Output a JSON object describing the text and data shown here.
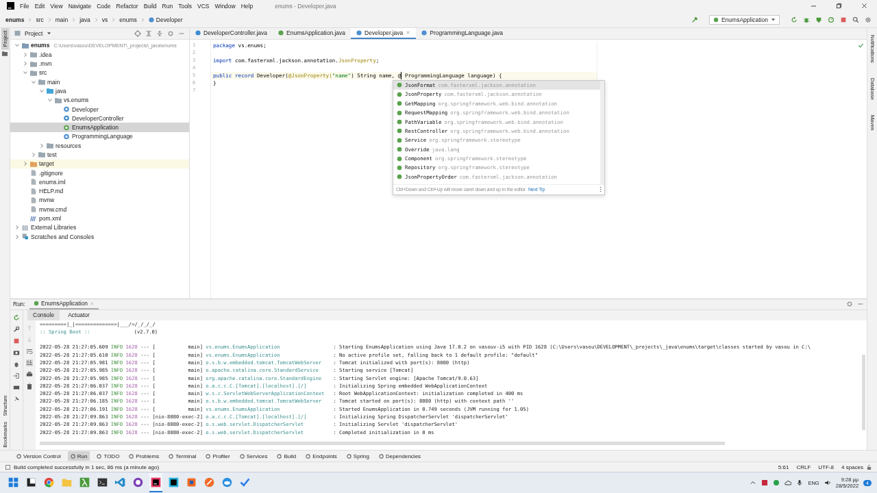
{
  "menu_bar": {
    "items": [
      "File",
      "Edit",
      "View",
      "Navigate",
      "Code",
      "Refactor",
      "Build",
      "Run",
      "Tools",
      "VCS",
      "Window",
      "Help"
    ],
    "title": "enums - Developer.java"
  },
  "breadcrumb": [
    {
      "label": "enums",
      "kind": "project"
    },
    {
      "label": "src",
      "kind": "folder"
    },
    {
      "label": "main",
      "kind": "folder"
    },
    {
      "label": "java",
      "kind": "folder"
    },
    {
      "label": "vs",
      "kind": "folder"
    },
    {
      "label": "enums",
      "kind": "folder"
    },
    {
      "label": "Developer",
      "kind": "record"
    }
  ],
  "run_config": "EnumsApplication",
  "left_stripe": {
    "top": [
      {
        "label": "Project",
        "selected": true
      }
    ],
    "bottom": [
      {
        "label": "Structure",
        "selected": false
      },
      {
        "label": "Bookmarks",
        "selected": false
      }
    ]
  },
  "right_stripe": [
    {
      "label": "Notifications",
      "selected": false
    },
    {
      "label": "Database",
      "selected": false
    },
    {
      "label": "Maven",
      "selected": false
    }
  ],
  "project_panel": {
    "title": "Project",
    "tree": [
      {
        "name": "enums",
        "path": "C:\\Users\\vasou\\DEVELOPMENT\\_projects\\_java\\enums",
        "kind": "module",
        "expanded": true,
        "selected": false,
        "children": [
          {
            "name": ".idea",
            "kind": "folder",
            "expanded": false,
            "selected": false
          },
          {
            "name": ".mvn",
            "kind": "folder",
            "expanded": false,
            "selected": false
          },
          {
            "name": "src",
            "kind": "folder",
            "expanded": true,
            "selected": false,
            "children": [
              {
                "name": "main",
                "kind": "folder",
                "expanded": true,
                "selected": false,
                "children": [
                  {
                    "name": "java",
                    "kind": "source",
                    "expanded": true,
                    "selected": false,
                    "children": [
                      {
                        "name": "vs.enums",
                        "kind": "package",
                        "expanded": true,
                        "selected": false,
                        "children": [
                          {
                            "name": "Developer",
                            "kind": "record",
                            "selected": false
                          },
                          {
                            "name": "DeveloperController",
                            "kind": "class",
                            "selected": false
                          },
                          {
                            "name": "EnumsApplication",
                            "kind": "app",
                            "selected": true
                          },
                          {
                            "name": "ProgrammingLanguage",
                            "kind": "enum",
                            "selected": false
                          }
                        ]
                      }
                    ]
                  },
                  {
                    "name": "resources",
                    "kind": "resources",
                    "expanded": false,
                    "selected": false
                  }
                ]
              },
              {
                "name": "test",
                "kind": "folder",
                "expanded": false,
                "selected": false
              }
            ]
          },
          {
            "name": "target",
            "kind": "excluded",
            "expanded": false,
            "selected": false
          },
          {
            "name": ".gitignore",
            "kind": "file",
            "selected": false
          },
          {
            "name": "enums.iml",
            "kind": "file",
            "selected": false
          },
          {
            "name": "HELP.md",
            "kind": "file",
            "selected": false
          },
          {
            "name": "mvnw",
            "kind": "file",
            "selected": false
          },
          {
            "name": "mvnw.cmd",
            "kind": "file",
            "selected": false
          },
          {
            "name": "pom.xml",
            "kind": "maven",
            "selected": false
          }
        ]
      },
      {
        "name": "External Libraries",
        "kind": "library",
        "expanded": false,
        "selected": false
      },
      {
        "name": "Scratches and Consoles",
        "kind": "scratches",
        "expanded": false,
        "selected": false
      }
    ]
  },
  "editor": {
    "tabs": [
      {
        "label": "DeveloperController.java",
        "kind": "class",
        "selected": false
      },
      {
        "label": "EnumsApplication.java",
        "kind": "app",
        "selected": false
      },
      {
        "label": "Developer.java",
        "kind": "record",
        "selected": true
      },
      {
        "label": "ProgrammingLanguage.java",
        "kind": "enum",
        "selected": false
      }
    ],
    "lines": [
      {
        "number": "1",
        "current": false,
        "tokens": [
          {
            "text": "package",
            "kind": "keyword",
            "caret": false
          },
          {
            "text": " vs.enums;",
            "kind": "plain",
            "caret": false
          }
        ]
      },
      {
        "number": "2",
        "current": false
      },
      {
        "number": "3",
        "current": false,
        "tokens": [
          {
            "text": "import",
            "kind": "keyword",
            "caret": false
          },
          {
            "text": " com.fasterxml.jackson.annotation.",
            "kind": "plain",
            "caret": false
          },
          {
            "text": "JsonProperty",
            "kind": "annotation",
            "caret": false
          },
          {
            "text": ";",
            "kind": "plain",
            "caret": false
          }
        ]
      },
      {
        "number": "4",
        "current": false
      },
      {
        "number": "5",
        "current": true,
        "tokens": [
          {
            "text": "public record",
            "kind": "keyword",
            "caret": false
          },
          {
            "text": " Developer(",
            "kind": "plain",
            "caret": false
          },
          {
            "text": "@JsonProperty(",
            "kind": "annotation",
            "caret": false
          },
          {
            "text": "\"name\"",
            "kind": "string",
            "caret": false
          },
          {
            "text": ") String name, @",
            "kind": "plain",
            "caret": true
          },
          {
            "text": " ProgrammingLanguage language) {",
            "kind": "plain",
            "caret": false
          }
        ]
      },
      {
        "number": "6",
        "current": false,
        "tokens": [
          {
            "text": "}",
            "kind": "plain",
            "caret": false
          }
        ]
      },
      {
        "number": "7",
        "current": false
      }
    ],
    "completion": {
      "items": [
        {
          "name": "JsonFormat",
          "package": "com.fasterxml.jackson.annotation",
          "selected": true
        },
        {
          "name": "JsonProperty",
          "package": "com.fasterxml.jackson.annotation",
          "selected": false
        },
        {
          "name": "GetMapping",
          "package": "org.springframework.web.bind.annotation",
          "selected": false
        },
        {
          "name": "RequestMapping",
          "package": "org.springframework.web.bind.annotation",
          "selected": false
        },
        {
          "name": "PathVariable",
          "package": "org.springframework.web.bind.annotation",
          "selected": false
        },
        {
          "name": "RestController",
          "package": "org.springframework.web.bind.annotation",
          "selected": false
        },
        {
          "name": "Service",
          "package": "org.springframework.stereotype",
          "selected": false
        },
        {
          "name": "Override",
          "package": "java.lang",
          "selected": false
        },
        {
          "name": "Component",
          "package": "org.springframework.stereotype",
          "selected": false
        },
        {
          "name": "Repository",
          "package": "org.springframework.stereotype",
          "selected": false
        },
        {
          "name": "JsonPropertyOrder",
          "package": "com.fasterxml.jackson.annotation",
          "selected": false
        }
      ],
      "hint": "Ctrl+Down and Ctrl+Up will move caret down and up in the editor",
      "hint_link": "Next Tip"
    }
  },
  "run_panel": {
    "label": "Run:",
    "tab": "EnumsApplication",
    "tabs": [
      {
        "label": "Console",
        "selected": true
      },
      {
        "label": "Actuator",
        "selected": false
      }
    ],
    "banner": "=========|_|==============|___/=/_/_/_/",
    "boot_label": ":: Spring Boot ::",
    "boot_version": "(v2.7.0)",
    "logs": [
      {
        "time": "2022-05-28 21:27:05.609",
        "level": "INFO",
        "pid": "1628",
        "sep": "---",
        "thread": "[           main]",
        "logger": "vs.enums.EnumsApplication",
        "message": ": Starting EnumsApplication using Java 17.0.2 on vasouv-i5 with PID 1628 (C:\\Users\\vasou\\DEVELOPMENT\\_projects\\_java\\enums\\target\\classes started by vasou in C:\\"
      },
      {
        "time": "2022-05-28 21:27:05.610",
        "level": "INFO",
        "pid": "1628",
        "sep": "---",
        "thread": "[           main]",
        "logger": "vs.enums.EnumsApplication",
        "message": ": No active profile set, falling back to 1 default profile: \"default\""
      },
      {
        "time": "2022-05-28 21:27:05.981",
        "level": "INFO",
        "pid": "1628",
        "sep": "---",
        "thread": "[           main]",
        "logger": "o.s.b.w.embedded.tomcat.TomcatWebServer",
        "message": ": Tomcat initialized with port(s): 8080 (http)"
      },
      {
        "time": "2022-05-28 21:27:05.985",
        "level": "INFO",
        "pid": "1628",
        "sep": "---",
        "thread": "[           main]",
        "logger": "o.apache.catalina.core.StandardService",
        "message": ": Starting service [Tomcat]"
      },
      {
        "time": "2022-05-28 21:27:05.985",
        "level": "INFO",
        "pid": "1628",
        "sep": "---",
        "thread": "[           main]",
        "logger": "org.apache.catalina.core.StandardEngine",
        "message": ": Starting Servlet engine: [Apache Tomcat/9.0.63]"
      },
      {
        "time": "2022-05-28 21:27:06.037",
        "level": "INFO",
        "pid": "1628",
        "sep": "---",
        "thread": "[           main]",
        "logger": "o.a.c.c.C.[Tomcat].[localhost].[/]",
        "message": ": Initializing Spring embedded WebApplicationContext"
      },
      {
        "time": "2022-05-28 21:27:06.037",
        "level": "INFO",
        "pid": "1628",
        "sep": "---",
        "thread": "[           main]",
        "logger": "w.s.c.ServletWebServerApplicationContext",
        "message": ": Root WebApplicationContext: initialization completed in 400 ms"
      },
      {
        "time": "2022-05-28 21:27:06.185",
        "level": "INFO",
        "pid": "1628",
        "sep": "---",
        "thread": "[           main]",
        "logger": "o.s.b.w.embedded.tomcat.TomcatWebServer",
        "message": ": Tomcat started on port(s): 8080 (http) with context path ''"
      },
      {
        "time": "2022-05-28 21:27:06.191",
        "level": "INFO",
        "pid": "1628",
        "sep": "---",
        "thread": "[           main]",
        "logger": "vs.enums.EnumsApplication",
        "message": ": Started EnumsApplication in 0.749 seconds (JVM running for 1.05)"
      },
      {
        "time": "2022-05-28 21:27:09.863",
        "level": "INFO",
        "pid": "1628",
        "sep": "---",
        "thread": "[nio-8080-exec-2]",
        "logger": "o.a.c.c.C.[Tomcat].[localhost].[/]",
        "message": ": Initializing Spring DispatcherServlet 'dispatcherServlet'"
      },
      {
        "time": "2022-05-28 21:27:09.863",
        "level": "INFO",
        "pid": "1628",
        "sep": "---",
        "thread": "[nio-8080-exec-2]",
        "logger": "o.s.web.servlet.DispatcherServlet",
        "message": ": Initializing Servlet 'dispatcherServlet'"
      },
      {
        "time": "2022-05-28 21:27:09.863",
        "level": "INFO",
        "pid": "1628",
        "sep": "---",
        "thread": "[nio-8080-exec-2]",
        "logger": "o.s.web.servlet.DispatcherServlet",
        "message": ": Completed initialization in 0 ms"
      }
    ]
  },
  "tool_windows": [
    {
      "label": "Version Control",
      "selected": false
    },
    {
      "label": "Run",
      "selected": true
    },
    {
      "label": "TODO",
      "selected": false
    },
    {
      "label": "Problems",
      "selected": false
    },
    {
      "label": "Terminal",
      "selected": false
    },
    {
      "label": "Profiler",
      "selected": false
    },
    {
      "label": "Services",
      "selected": false
    },
    {
      "label": "Build",
      "selected": false
    },
    {
      "label": "Endpoints",
      "selected": false
    },
    {
      "label": "Spring",
      "selected": false
    },
    {
      "label": "Dependencies",
      "selected": false
    }
  ],
  "status_bar": {
    "message": "Build completed successfully in 1 sec, 86 ms (a minute ago)",
    "items": [
      "5:61",
      "CRLF",
      "UTF-8",
      "4 spaces"
    ]
  },
  "taskbar": {
    "apps": [
      {
        "kind": "start",
        "selected": false
      },
      {
        "kind": "dark",
        "selected": false
      },
      {
        "kind": "browser",
        "selected": false
      },
      {
        "kind": "folder",
        "selected": false
      },
      {
        "kind": "lambda",
        "selected": false
      },
      {
        "kind": "terminal",
        "selected": false
      },
      {
        "kind": "code",
        "selected": false
      },
      {
        "kind": "purple",
        "selected": false
      },
      {
        "kind": "ide",
        "selected": true
      },
      {
        "kind": "ide2",
        "selected": false
      },
      {
        "kind": "orange-square",
        "selected": false
      },
      {
        "kind": "orange-circle",
        "selected": false
      },
      {
        "kind": "blue-circle",
        "selected": false
      },
      {
        "kind": "check",
        "selected": false
      }
    ],
    "language": "ENG",
    "time": "9:28 μμ",
    "date": "28/5/2022",
    "notifications": "4"
  }
}
